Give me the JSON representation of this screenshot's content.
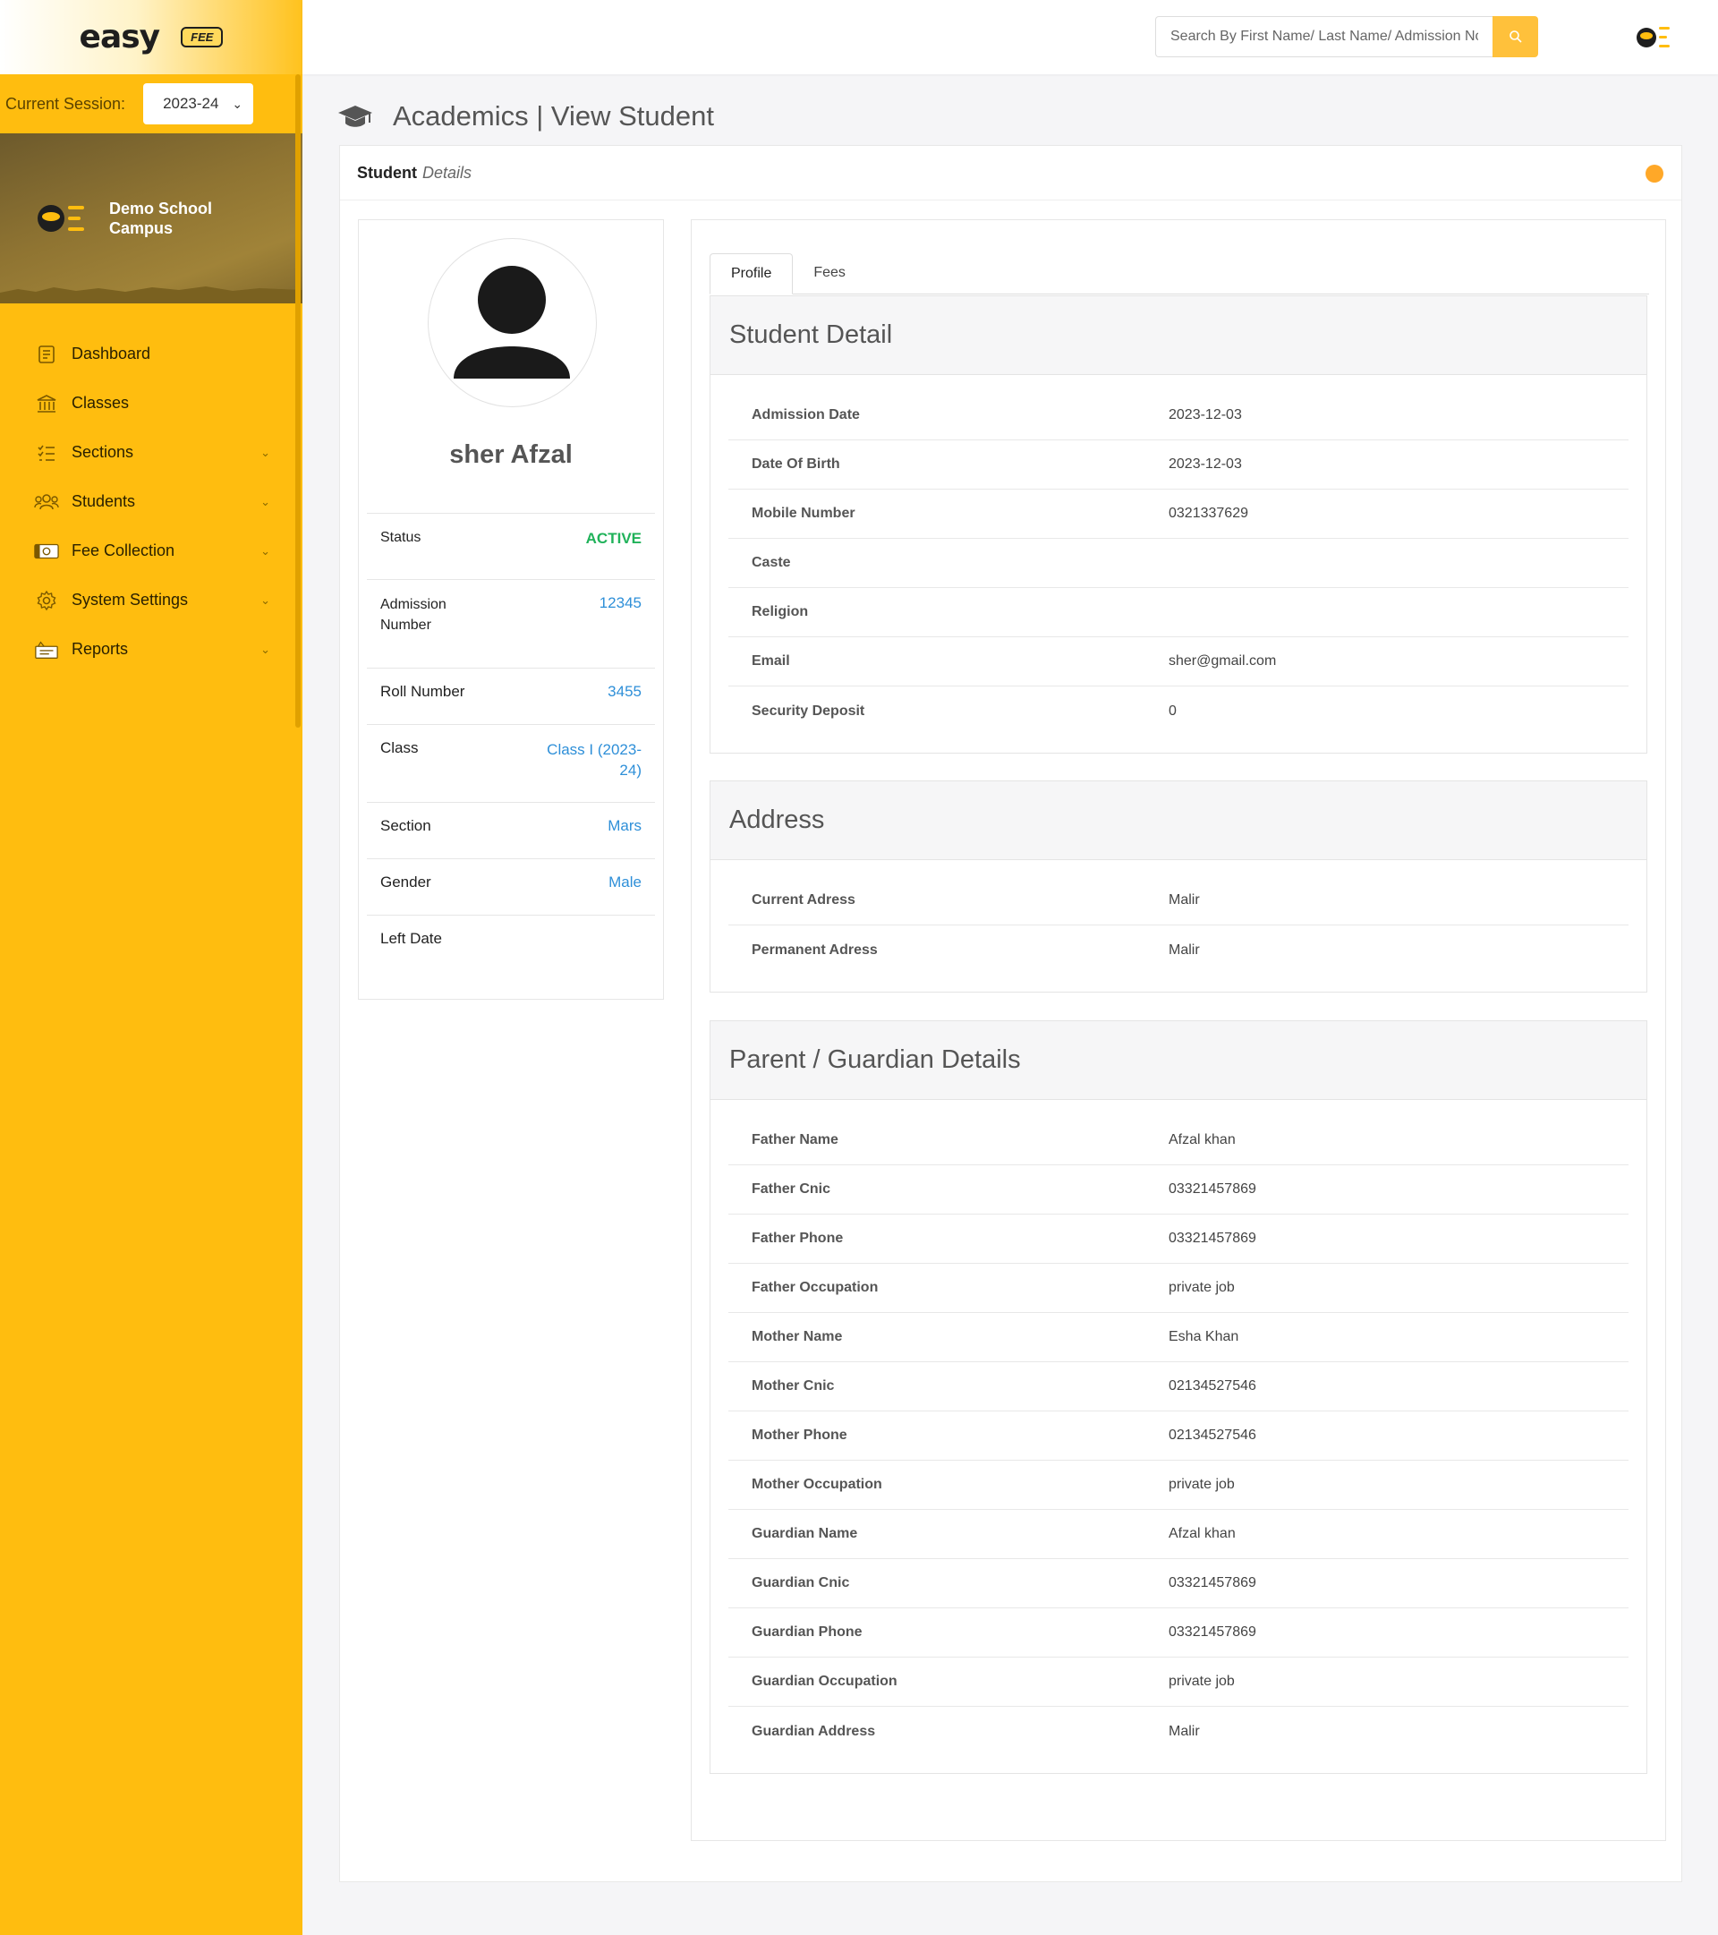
{
  "app": {
    "logo_text": "easy",
    "logo_badge": "FEE"
  },
  "session": {
    "label": "Current Session:",
    "value": "2023-24"
  },
  "campus": {
    "name": "Demo School Campus"
  },
  "sidebar": {
    "items": [
      {
        "label": "Dashboard",
        "icon": "dashboard-icon",
        "has_submenu": false
      },
      {
        "label": "Classes",
        "icon": "classes-icon",
        "has_submenu": false
      },
      {
        "label": "Sections",
        "icon": "sections-icon",
        "has_submenu": true
      },
      {
        "label": "Students",
        "icon": "students-icon",
        "has_submenu": true
      },
      {
        "label": "Fee Collection",
        "icon": "fee-collection-icon",
        "has_submenu": true
      },
      {
        "label": "System Settings",
        "icon": "gear-icon",
        "has_submenu": true
      },
      {
        "label": "Reports",
        "icon": "reports-icon",
        "has_submenu": true
      }
    ]
  },
  "search": {
    "placeholder": "Search By First Name/ Last Name/ Admission No"
  },
  "page": {
    "title": "Academics | View Student"
  },
  "card": {
    "title_bold": "Student",
    "title_italic": "Details"
  },
  "profile": {
    "name": "sher Afzal",
    "rows": [
      {
        "label": "Status",
        "value": "ACTIVE"
      },
      {
        "label": "Admission Number",
        "value": "12345"
      },
      {
        "label": "Roll Number",
        "value": "3455"
      },
      {
        "label": "Class",
        "value": "Class I (2023-24)"
      },
      {
        "label": "Section",
        "value": "Mars"
      },
      {
        "label": "Gender",
        "value": "Male"
      },
      {
        "label": "Left Date",
        "value": ""
      }
    ]
  },
  "tabs": [
    {
      "label": "Profile",
      "active": true
    },
    {
      "label": "Fees",
      "active": false
    }
  ],
  "student_detail": {
    "title": "Student Detail",
    "rows": [
      {
        "label": "Admission Date",
        "value": "2023-12-03"
      },
      {
        "label": "Date Of Birth",
        "value": "2023-12-03"
      },
      {
        "label": "Mobile Number",
        "value": "0321337629"
      },
      {
        "label": "Caste",
        "value": ""
      },
      {
        "label": "Religion",
        "value": ""
      },
      {
        "label": "Email",
        "value": "sher@gmail.com"
      },
      {
        "label": "Security Deposit",
        "value": "0"
      }
    ]
  },
  "address": {
    "title": "Address",
    "rows": [
      {
        "label": "Current Adress",
        "value": "Malir"
      },
      {
        "label": "Permanent Adress",
        "value": "Malir"
      }
    ]
  },
  "guardian": {
    "title": "Parent / Guardian Details",
    "rows": [
      {
        "label": "Father Name",
        "value": "Afzal khan"
      },
      {
        "label": "Father Cnic",
        "value": "03321457869"
      },
      {
        "label": "Father Phone",
        "value": "03321457869"
      },
      {
        "label": "Father Occupation",
        "value": "private job"
      },
      {
        "label": "Mother Name",
        "value": "Esha Khan"
      },
      {
        "label": "Mother Cnic",
        "value": "02134527546"
      },
      {
        "label": "Mother Phone",
        "value": "02134527546"
      },
      {
        "label": "Mother Occupation",
        "value": "private job"
      },
      {
        "label": "Guardian Name",
        "value": "Afzal khan"
      },
      {
        "label": "Guardian Cnic",
        "value": "03321457869"
      },
      {
        "label": "Guardian Phone",
        "value": "03321457869"
      },
      {
        "label": "Guardian Occupation",
        "value": "private job"
      },
      {
        "label": "Guardian Address",
        "value": "Malir"
      }
    ]
  },
  "colors": {
    "sidebar": "#ffbd0f",
    "accent": "#ffc13b",
    "status_active": "#20b25a",
    "link": "#2e8fd8"
  }
}
